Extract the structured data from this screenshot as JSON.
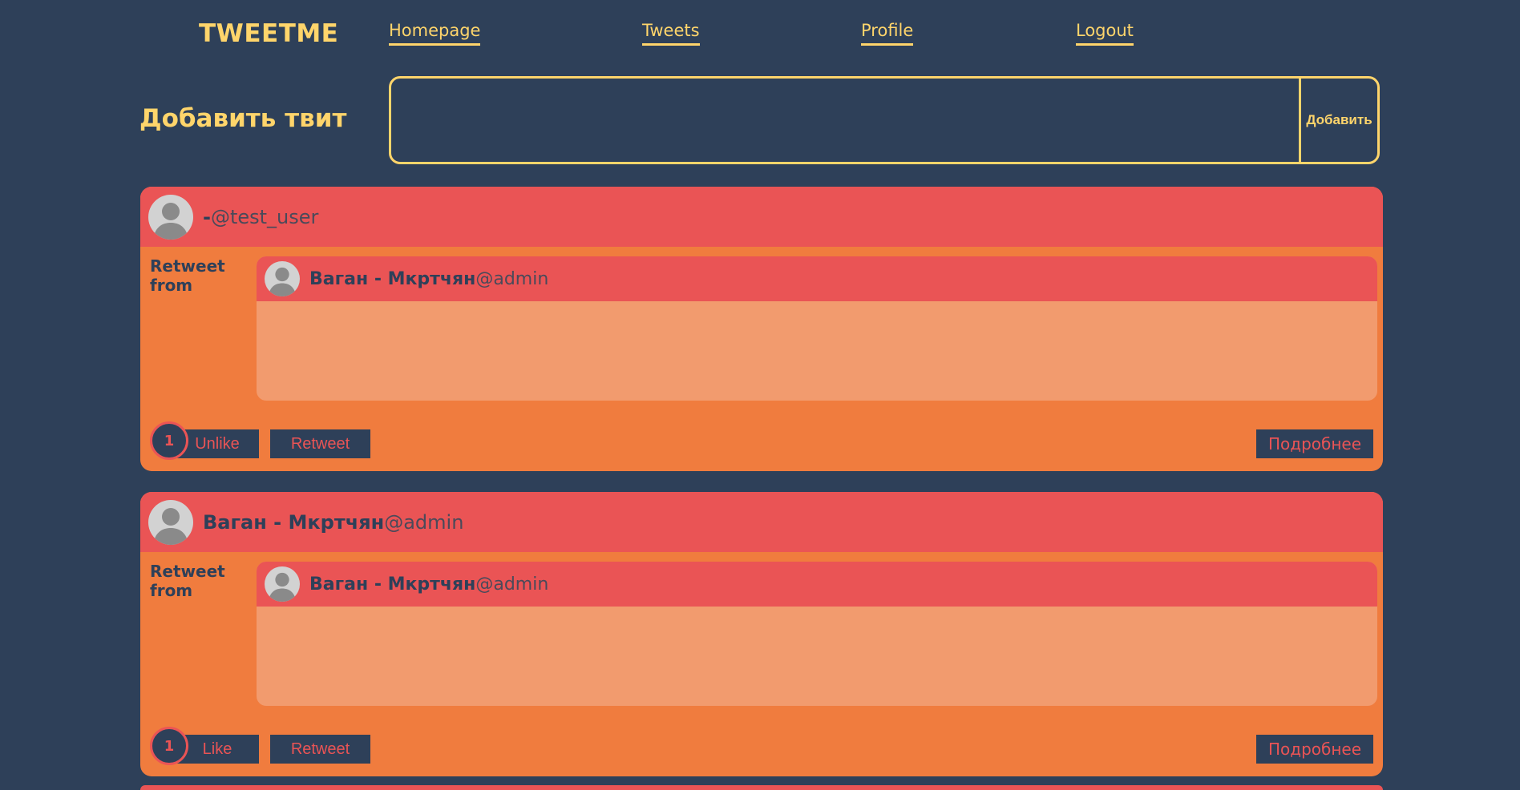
{
  "brand": "TWEETME",
  "nav": [
    {
      "label": "Homepage"
    },
    {
      "label": "Tweets"
    },
    {
      "label": "Profile"
    },
    {
      "label": "Logout"
    }
  ],
  "composer": {
    "title": "Добавить твит",
    "placeholder": "",
    "submit_label": "Добавить"
  },
  "tweets": [
    {
      "author_name": "-",
      "author_handle": "@test_user",
      "retweet_label": "Retweet from",
      "original": {
        "author_name": "Ваган - Мкртчян",
        "author_handle": "@admin",
        "content": ""
      },
      "like_count": "1",
      "like_label": "Unlike",
      "retweet_button": "Retweet",
      "details_label": "Подробнее"
    },
    {
      "author_name": "Ваган - Мкртчян",
      "author_handle": "@admin",
      "retweet_label": "Retweet from",
      "original": {
        "author_name": "Ваган - Мкртчян",
        "author_handle": "@admin",
        "content": ""
      },
      "like_count": "1",
      "like_label": "Like",
      "retweet_button": "Retweet",
      "details_label": "Подробнее"
    }
  ],
  "colors": {
    "background": "#2e4059",
    "accent": "#ffd56b",
    "header_red": "#ea5455",
    "card_orange": "#f07c3e",
    "inner_peach": "#f29b6e"
  }
}
